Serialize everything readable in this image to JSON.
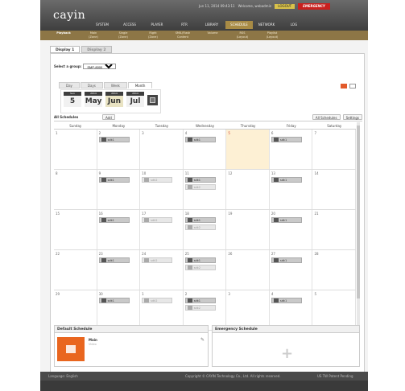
{
  "header": {
    "logo": "cayin",
    "datetime": "Jun 11, 2014 09:43:11",
    "welcome": "Welcome, webadmin",
    "logout_label": "LOGOUT",
    "emergency_label": "EMERGENCY"
  },
  "main_nav": [
    "SYSTEM",
    "ACCESS",
    "PLAYER",
    "RTR",
    "LIBRARY",
    "SCHEDULE",
    "NETWORK",
    "LOG"
  ],
  "main_nav_active": "SCHEDULE",
  "sub_nav": [
    {
      "line1": "Playback",
      "line2": ""
    },
    {
      "line1": "Main",
      "line2": "(Zone)"
    },
    {
      "line1": "Single",
      "line2": "(Zone)"
    },
    {
      "line1": "Right",
      "line2": "(Zone)"
    },
    {
      "line1": "SMIL/Flash",
      "line2": "Content"
    },
    {
      "line1": "Volume",
      "line2": ""
    },
    {
      "line1": "RSS",
      "line2": "(Layout)"
    },
    {
      "line1": "Playlist",
      "line2": "(Layout)"
    }
  ],
  "display_tabs": [
    "Display 1",
    "Display 2"
  ],
  "group": {
    "label": "Select a group:",
    "value": "SMP-8000"
  },
  "view_tabs": [
    "Day",
    "Days",
    "Week",
    "Month"
  ],
  "months": [
    {
      "year": "Sun",
      "month": "5"
    },
    {
      "year": "2014",
      "month": "May"
    },
    {
      "year": "2014",
      "month": "Jun"
    },
    {
      "year": "2014",
      "month": "Jul"
    }
  ],
  "schedule_bar": {
    "title": "All Schedules",
    "add_label": "Add",
    "all_label": "All Schedules",
    "settings_label": "Settings"
  },
  "dow": [
    "Sunday",
    "Monday",
    "Tuesday",
    "Wednesday",
    "Thursday",
    "Friday",
    "Saturday"
  ],
  "weeks": [
    [
      {
        "num": "1",
        "events": []
      },
      {
        "num": "2",
        "events": [
          {
            "label": "sdk1",
            "dim": false
          }
        ]
      },
      {
        "num": "3",
        "events": []
      },
      {
        "num": "4",
        "events": [
          {
            "label": "sdk1",
            "dim": false
          }
        ]
      },
      {
        "num": "5",
        "events": [],
        "today": true
      },
      {
        "num": "6",
        "events": [
          {
            "label": "sdk1",
            "dim": false
          }
        ]
      },
      {
        "num": "7",
        "events": []
      }
    ],
    [
      {
        "num": "8",
        "events": []
      },
      {
        "num": "9",
        "events": [
          {
            "label": "sdk1",
            "dim": false
          }
        ]
      },
      {
        "num": "10",
        "events": [
          {
            "label": "sdk2",
            "dim": true
          }
        ]
      },
      {
        "num": "11",
        "events": [
          {
            "label": "sdk1",
            "dim": false
          },
          {
            "label": "sdk2",
            "dim": true
          }
        ]
      },
      {
        "num": "12",
        "events": []
      },
      {
        "num": "13",
        "events": [
          {
            "label": "sdk1",
            "dim": false
          }
        ]
      },
      {
        "num": "14",
        "events": []
      }
    ],
    [
      {
        "num": "15",
        "events": []
      },
      {
        "num": "16",
        "events": [
          {
            "label": "sdk1",
            "dim": false
          }
        ]
      },
      {
        "num": "17",
        "events": [
          {
            "label": "sdk2",
            "dim": true
          }
        ]
      },
      {
        "num": "18",
        "events": [
          {
            "label": "sdk1",
            "dim": false
          },
          {
            "label": "sdk2",
            "dim": true
          }
        ]
      },
      {
        "num": "19",
        "events": []
      },
      {
        "num": "20",
        "events": [
          {
            "label": "sdk1",
            "dim": false
          }
        ]
      },
      {
        "num": "21",
        "events": []
      }
    ],
    [
      {
        "num": "22",
        "events": []
      },
      {
        "num": "23",
        "events": [
          {
            "label": "sdk1",
            "dim": false
          }
        ]
      },
      {
        "num": "24",
        "events": [
          {
            "label": "sdk2",
            "dim": true
          }
        ]
      },
      {
        "num": "25",
        "events": [
          {
            "label": "sdk1",
            "dim": false
          },
          {
            "label": "sdk2",
            "dim": true
          }
        ]
      },
      {
        "num": "26",
        "events": []
      },
      {
        "num": "27",
        "events": [
          {
            "label": "sdk1",
            "dim": false
          }
        ]
      },
      {
        "num": "28",
        "events": []
      }
    ],
    [
      {
        "num": "29",
        "events": []
      },
      {
        "num": "30",
        "events": [
          {
            "label": "sdk1",
            "dim": false
          }
        ]
      },
      {
        "num": "1",
        "events": [
          {
            "label": "sdk2",
            "dim": true
          }
        ]
      },
      {
        "num": "2",
        "events": [
          {
            "label": "sdk1",
            "dim": false
          },
          {
            "label": "sdk2",
            "dim": true
          }
        ]
      },
      {
        "num": "3",
        "events": []
      },
      {
        "num": "4",
        "events": [
          {
            "label": "sdk1",
            "dim": false
          }
        ]
      },
      {
        "num": "5",
        "events": []
      }
    ]
  ],
  "default_schedule": {
    "title": "Default Schedule",
    "name": "Main",
    "sub": "Video"
  },
  "emergency_schedule": {
    "title": "Emergency Schedule"
  },
  "footer": {
    "language": "Language: English",
    "copyright": "Copyright © CAYIN Technology Co., Ltd. All rights reserved.",
    "patent": "US TW Patent Pending"
  },
  "colors": {
    "accent": "#8d7646",
    "emergency": "#c9201e",
    "today": "#fdf0d4",
    "default_tile": "#e9661f"
  }
}
